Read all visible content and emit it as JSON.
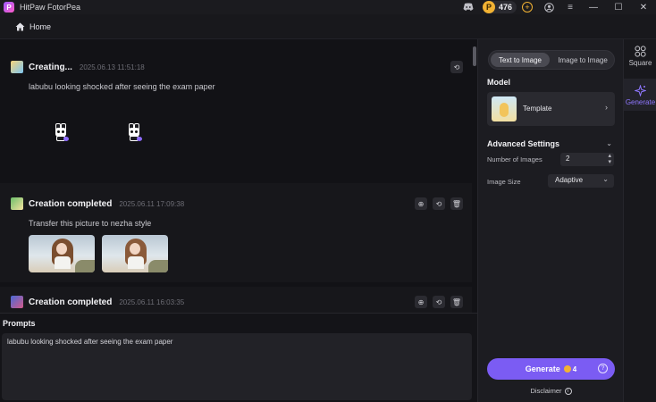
{
  "window": {
    "title": "HitPaw FotorPea",
    "credits": "476"
  },
  "nav": {
    "home_label": "Home"
  },
  "feed": {
    "cards": [
      {
        "status": "Creating...",
        "time": "2025.06.13   11:51:18",
        "prompt": "labubu looking shocked after seeing the exam paper"
      },
      {
        "status": "Creation completed",
        "time": "2025.06.11   17:09:38",
        "prompt": "Transfer this picture to nezha style"
      },
      {
        "status": "Creation completed",
        "time": "2025.06.11   16:03:35"
      }
    ]
  },
  "prompts": {
    "title": "Prompts",
    "text": "labubu looking shocked after seeing the exam paper"
  },
  "settings": {
    "tabs": [
      "Text to Image",
      "Image to Image"
    ],
    "active_tab": "Text to Image",
    "model_title": "Model",
    "model_label": "Template",
    "advanced_title": "Advanced Settings",
    "num_images_label": "Number of Images",
    "num_images_value": "2",
    "image_size_label": "Image Size",
    "image_size_value": "Adaptive",
    "generate_label": "Generate",
    "generate_cost": "4",
    "disclaimer_label": "Disclaimer"
  },
  "rail": {
    "square_label": "Square",
    "generate_label": "Generate"
  },
  "colors": {
    "accent": "#7b5cf3",
    "coin": "#f2b233",
    "background": "#121216"
  }
}
